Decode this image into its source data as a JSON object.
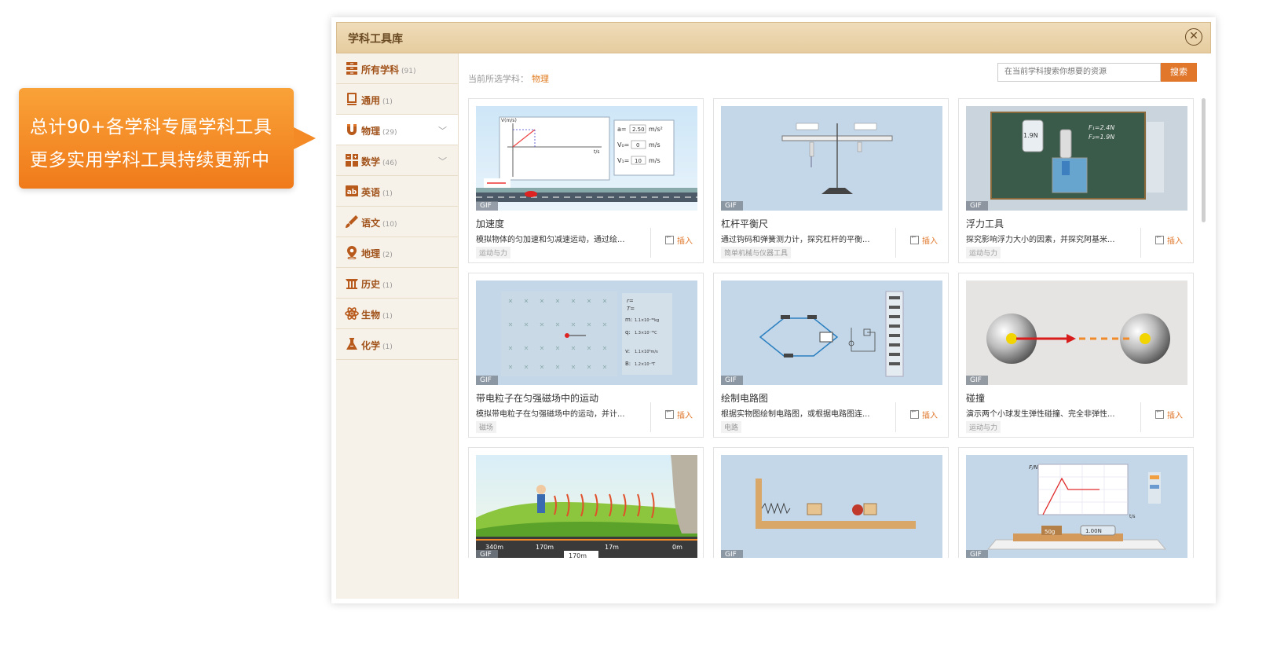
{
  "callout": {
    "line1": "总计90+各学科专属学科工具",
    "line2": "更多实用学科工具持续更新中"
  },
  "window": {
    "title": "学科工具库",
    "close": "✕"
  },
  "sidebar": {
    "items": [
      {
        "label": "所有学科",
        "count": "(91)",
        "icon": "stack-icon"
      },
      {
        "label": "通用",
        "count": "(1)",
        "icon": "book-icon"
      },
      {
        "label": "物理",
        "count": "(29)",
        "icon": "magnet-icon",
        "active": true,
        "chevron": "﹀"
      },
      {
        "label": "数学",
        "count": "(46)",
        "icon": "grid-icon",
        "chevron": "﹀"
      },
      {
        "label": "英语",
        "count": "(1)",
        "icon": "english-icon"
      },
      {
        "label": "语文",
        "count": "(10)",
        "icon": "brush-icon"
      },
      {
        "label": "地理",
        "count": "(2)",
        "icon": "location-icon"
      },
      {
        "label": "历史",
        "count": "(1)",
        "icon": "temple-icon"
      },
      {
        "label": "生物",
        "count": "(1)",
        "icon": "atom-icon"
      },
      {
        "label": "化学",
        "count": "(1)",
        "icon": "flask-icon"
      }
    ]
  },
  "main": {
    "crumb_label": "当前所选学科：",
    "crumb_value": "物理",
    "search_placeholder": "在当前学科搜索你想要的资源",
    "search_button": "搜索",
    "gif_label": "GIF",
    "insert_label": "插入",
    "cards": [
      {
        "title": "加速度",
        "desc": "模拟物体的匀加速和匀减速运动，通过绘...",
        "tag": "运动与力"
      },
      {
        "title": "杠杆平衡尺",
        "desc": "通过钩码和弹簧测力计，探究杠杆的平衡...",
        "tag": "简单机械与仪器工具"
      },
      {
        "title": "浮力工具",
        "desc": "探究影响浮力大小的因素，并探究阿基米...",
        "tag": "运动与力"
      },
      {
        "title": "带电粒子在匀强磁场中的运动",
        "desc": "模拟带电粒子在匀强磁场中的运动，并计...",
        "tag": "磁场"
      },
      {
        "title": "绘制电路图",
        "desc": "根据实物图绘制电路图，或根据电路图连...",
        "tag": "电路"
      },
      {
        "title": "碰撞",
        "desc": "演示两个小球发生弹性碰撞、完全非弹性...",
        "tag": "运动与力"
      },
      {
        "title": "",
        "desc": "",
        "tag": ""
      },
      {
        "title": "",
        "desc": "",
        "tag": ""
      },
      {
        "title": "",
        "desc": "",
        "tag": ""
      }
    ]
  },
  "thumb_text": {
    "accel_a": "a=",
    "accel_a_val": "2.50",
    "accel_unit1": "m/s²",
    "accel_v0": "V₀=",
    "accel_v0_val": "0",
    "accel_unit2": "m/s",
    "accel_v1": "V₁=",
    "accel_v1_val": "10",
    "accel_unit3": "m/s",
    "accel_axis": "V(m/s)",
    "accel_t": "t/s",
    "buoy_f1": "F₁=2.4N",
    "buoy_f2": "F₂=1.9N",
    "buoy_scale": "1.9N",
    "mag_r": "r=",
    "mag_t": "T=",
    "mag_m": "m:",
    "mag_m_val": "1.1×10⁻³⁰kg",
    "mag_q": "q:",
    "mag_q_val": "1.3×10⁻¹⁹C",
    "mag_v": "v:",
    "mag_v_val": "1.1×10⁵m/s",
    "mag_b": "B:",
    "mag_b_val": "1.2×10⁻³T",
    "sound_340": "340m",
    "sound_170": "170m",
    "sound_17": "17m",
    "sound_0": "0m",
    "sound_box": "170m",
    "friction_fn": "F/N",
    "friction_t": "t/s",
    "friction_mass": "50g",
    "friction_reading": "1.00N"
  }
}
